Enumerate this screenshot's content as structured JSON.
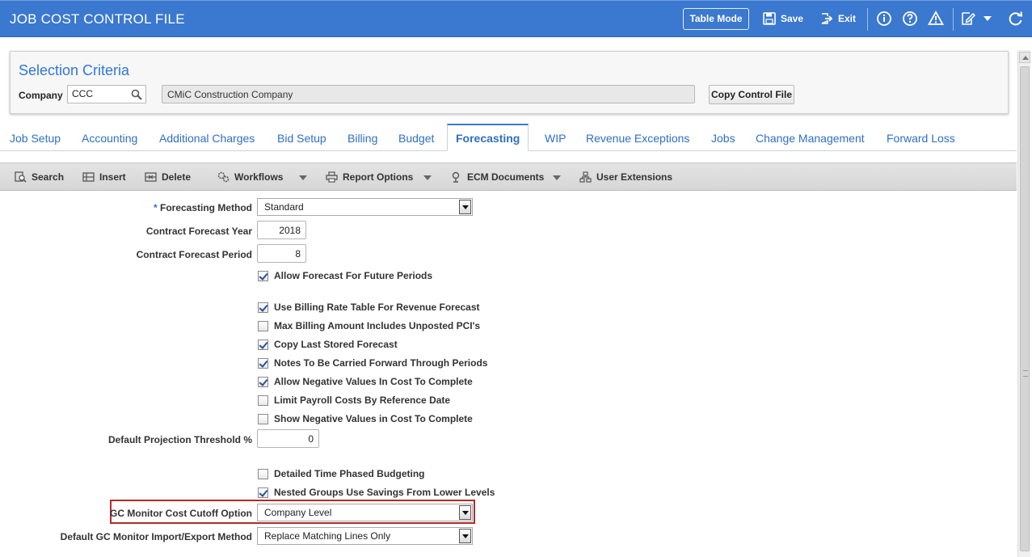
{
  "app": {
    "title": "JOB COST CONTROL FILE",
    "table_mode_label": "Table Mode",
    "save_label": "Save",
    "exit_label": "Exit"
  },
  "selection": {
    "title": "Selection Criteria",
    "company_label": "Company",
    "company_value": "CCC",
    "company_name": "CMiC Construction Company",
    "copy_button": "Copy Control File"
  },
  "tabs": [
    {
      "label": "Job Setup"
    },
    {
      "label": "Accounting"
    },
    {
      "label": "Additional Charges"
    },
    {
      "label": "Bid Setup"
    },
    {
      "label": "Billing"
    },
    {
      "label": "Budget"
    },
    {
      "label": "Forecasting",
      "active": true
    },
    {
      "label": "WIP"
    },
    {
      "label": "Revenue Exceptions"
    },
    {
      "label": "Jobs"
    },
    {
      "label": "Change Management"
    },
    {
      "label": "Forward Loss"
    }
  ],
  "toolbar": {
    "search": "Search",
    "insert": "Insert",
    "delete": "Delete",
    "workflows": "Workflows",
    "report_options": "Report Options",
    "ecm_documents": "ECM Documents",
    "user_extensions": "User Extensions"
  },
  "form": {
    "required_mark": "*",
    "forecasting_method_label": "Forecasting Method",
    "forecasting_method_value": "Standard",
    "contract_forecast_year_label": "Contract Forecast Year",
    "contract_forecast_year_value": "2018",
    "contract_forecast_period_label": "Contract Forecast Period",
    "contract_forecast_period_value": "8",
    "checkboxes_a": [
      {
        "label": "Allow Forecast For Future Periods",
        "checked": true
      }
    ],
    "checkboxes_b": [
      {
        "label": "Use Billing Rate Table For Revenue Forecast",
        "checked": true
      },
      {
        "label": "Max Billing Amount Includes Unposted PCI's",
        "checked": false
      },
      {
        "label": "Copy Last Stored Forecast",
        "checked": true
      },
      {
        "label": "Notes To Be Carried Forward Through Periods",
        "checked": true
      },
      {
        "label": "Allow Negative Values In Cost To Complete",
        "checked": true
      },
      {
        "label": "Limit Payroll Costs By Reference Date",
        "checked": false
      },
      {
        "label": "Show Negative Values in Cost To Complete",
        "checked": false
      }
    ],
    "projection_threshold_label": "Default Projection Threshold %",
    "projection_threshold_value": "0",
    "checkboxes_c": [
      {
        "label": "Detailed Time Phased Budgeting",
        "checked": false
      },
      {
        "label": "Nested Groups Use Savings From Lower Levels",
        "checked": true
      }
    ],
    "gc_cutoff_label": "GC Monitor Cost Cutoff Option",
    "gc_cutoff_value": "Company Level",
    "gc_import_label": "Default GC Monitor Import/Export Method",
    "gc_import_value": "Replace Matching Lines Only"
  },
  "colors": {
    "title_bar": "#3b78cf",
    "link_blue": "#2f6fc4",
    "highlight": "#b22b2b"
  }
}
